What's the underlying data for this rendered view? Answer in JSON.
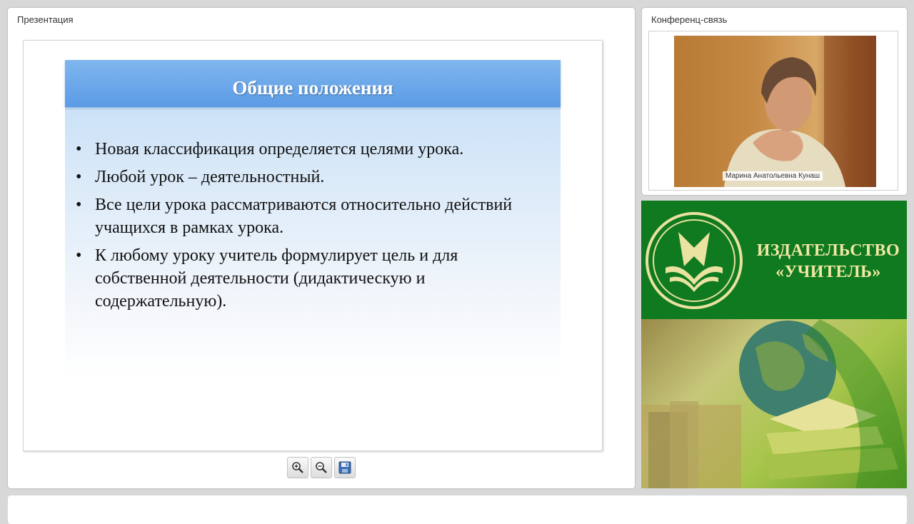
{
  "presentation": {
    "title": "Презентация",
    "slide": {
      "heading": "Общие положения",
      "bullets": [
        "Новая классификация определяется целями урока.",
        "Любой урок – деятельностный.",
        "Все цели урока рассматриваются относительно действий учащихся в рамках урока.",
        "К любому уроку учитель формулирует цель и для собственной деятельности (дидактическую и содержательную)."
      ]
    },
    "toolbar": {
      "zoom_in_icon": "zoom-in-icon",
      "zoom_out_icon": "zoom-out-icon",
      "save_icon": "save-icon"
    }
  },
  "conference": {
    "title": "Конференц-связь",
    "speaker_name": "Марина Анатольевна Кунаш"
  },
  "ad": {
    "publisher_line1": "ИЗДАТЕЛЬСТВО",
    "publisher_line2": "«УЧИТЕЛЬ»",
    "colors": {
      "banner_green": "#0f7a1f",
      "logo_gold": "#e9e2a0"
    }
  },
  "colors": {
    "slide_header": "#5b9be6",
    "slide_background": "#c1dcf6",
    "app_background": "#d8d8d8"
  }
}
